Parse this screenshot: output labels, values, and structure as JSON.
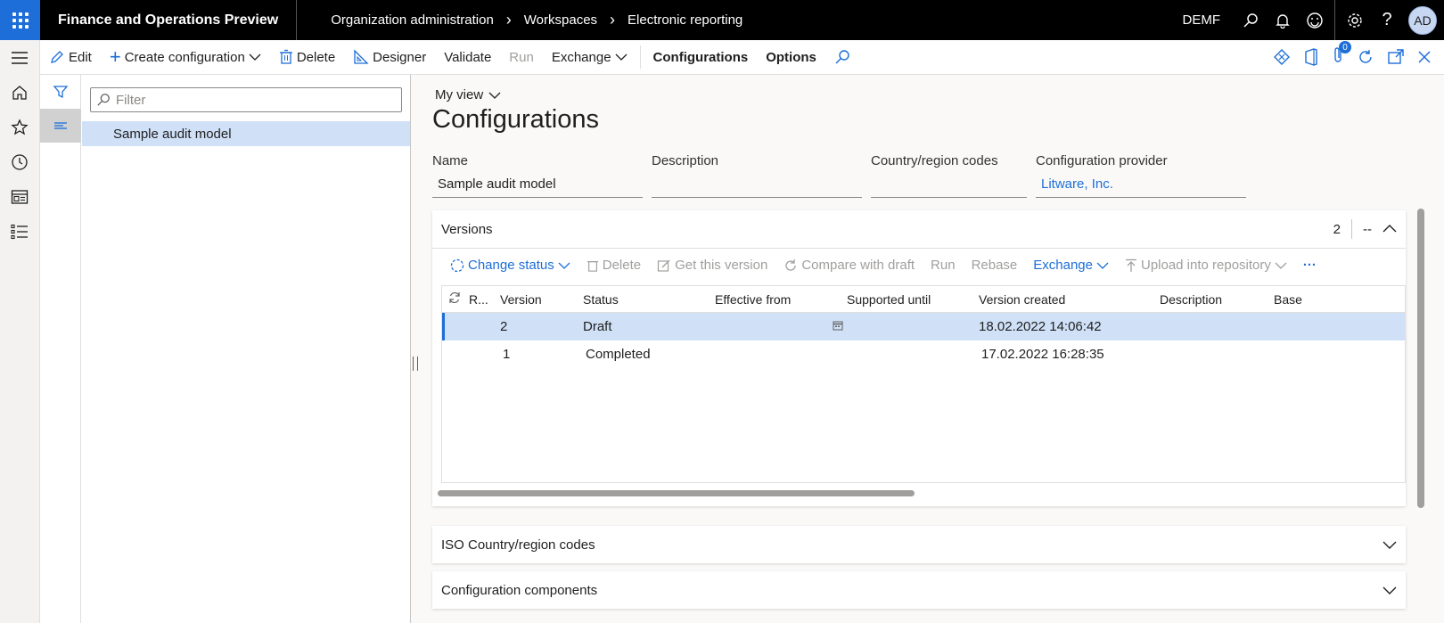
{
  "topbar": {
    "app_title": "Finance and Operations Preview",
    "breadcrumb": [
      "Organization administration",
      "Workspaces",
      "Electronic reporting"
    ],
    "company": "DEMF",
    "avatar": "AD"
  },
  "actions": {
    "edit": "Edit",
    "create_configuration": "Create configuration",
    "delete": "Delete",
    "designer": "Designer",
    "validate": "Validate",
    "run": "Run",
    "exchange": "Exchange",
    "configurations": "Configurations",
    "options": "Options",
    "attachments_count": "0"
  },
  "tree": {
    "filter_placeholder": "Filter",
    "items": [
      "Sample audit model"
    ]
  },
  "main": {
    "view": "My view",
    "title": "Configurations",
    "fields": {
      "name_label": "Name",
      "name_value": "Sample audit model",
      "description_label": "Description",
      "description_value": "",
      "country_label": "Country/region codes",
      "country_value": "",
      "provider_label": "Configuration provider",
      "provider_value": "Litware, Inc."
    }
  },
  "versions": {
    "title": "Versions",
    "count": "2",
    "nav": "--",
    "toolbar": {
      "change_status": "Change status",
      "delete": "Delete",
      "get_this_version": "Get this version",
      "compare_with_draft": "Compare with draft",
      "run": "Run",
      "rebase": "Rebase",
      "exchange": "Exchange",
      "upload": "Upload into repository",
      "more": "···"
    },
    "columns": {
      "r": "R...",
      "version": "Version",
      "status": "Status",
      "effective_from": "Effective from",
      "supported_until": "Supported until",
      "version_created": "Version created",
      "description": "Description",
      "base": "Base"
    },
    "rows": [
      {
        "version": "2",
        "status": "Draft",
        "created": "18.02.2022 14:06:42"
      },
      {
        "version": "1",
        "status": "Completed",
        "created": "17.02.2022 16:28:35"
      }
    ]
  },
  "sections": {
    "iso": "ISO Country/region codes",
    "components": "Configuration components"
  },
  "colors": {
    "accent": "#1d6ed8",
    "selected_row": "#cfe0f7",
    "topbar": "#000000"
  }
}
